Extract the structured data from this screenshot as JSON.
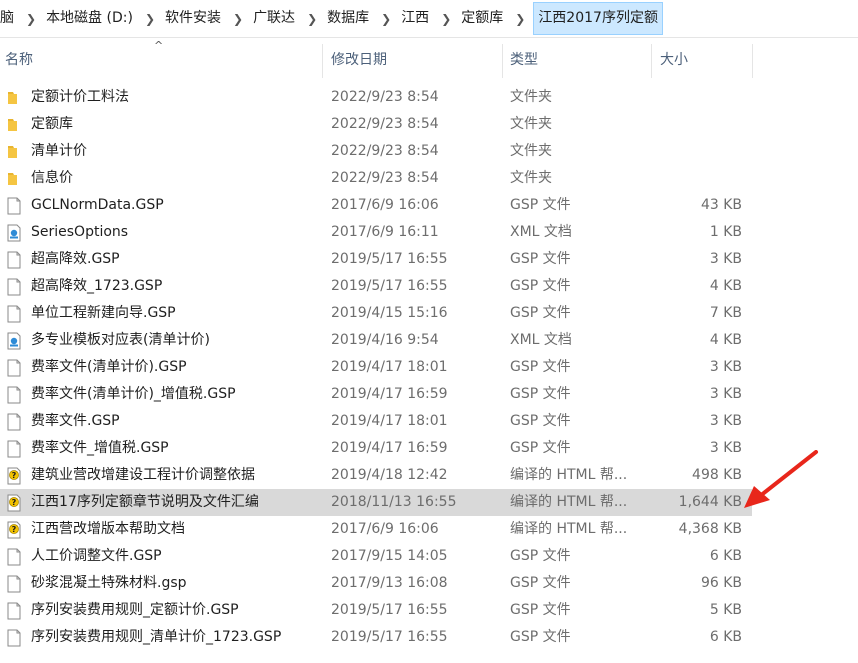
{
  "breadcrumb": {
    "items": [
      "脑",
      "本地磁盘 (D:)",
      "软件安装",
      "广联达",
      "数据库",
      "江西",
      "定额库",
      "江西2017序列定额"
    ]
  },
  "columns": {
    "name": "名称",
    "date": "修改日期",
    "type": "类型",
    "size": "大小"
  },
  "files": [
    {
      "icon": "folder-icon",
      "name": "定额计价工料法",
      "date": "2022/9/23 8:54",
      "type": "文件夹",
      "size": ""
    },
    {
      "icon": "folder-icon",
      "name": "定额库",
      "date": "2022/9/23 8:54",
      "type": "文件夹",
      "size": ""
    },
    {
      "icon": "folder-icon",
      "name": "清单计价",
      "date": "2022/9/23 8:54",
      "type": "文件夹",
      "size": ""
    },
    {
      "icon": "folder-icon",
      "name": "信息价",
      "date": "2022/9/23 8:54",
      "type": "文件夹",
      "size": ""
    },
    {
      "icon": "file-icon",
      "name": "GCLNormData.GSP",
      "date": "2017/6/9 16:06",
      "type": "GSP 文件",
      "size": "43 KB"
    },
    {
      "icon": "xml-file-icon",
      "name": "SeriesOptions",
      "date": "2017/6/9 16:11",
      "type": "XML 文档",
      "size": "1 KB"
    },
    {
      "icon": "file-icon",
      "name": "超高降效.GSP",
      "date": "2019/5/17 16:55",
      "type": "GSP 文件",
      "size": "3 KB"
    },
    {
      "icon": "file-icon",
      "name": "超高降效_1723.GSP",
      "date": "2019/5/17 16:55",
      "type": "GSP 文件",
      "size": "4 KB"
    },
    {
      "icon": "file-icon",
      "name": "单位工程新建向导.GSP",
      "date": "2019/4/15 15:16",
      "type": "GSP 文件",
      "size": "7 KB"
    },
    {
      "icon": "xml-file-icon",
      "name": "多专业模板对应表(清单计价)",
      "date": "2019/4/16 9:54",
      "type": "XML 文档",
      "size": "4 KB"
    },
    {
      "icon": "file-icon",
      "name": "费率文件(清单计价).GSP",
      "date": "2019/4/17 18:01",
      "type": "GSP 文件",
      "size": "3 KB"
    },
    {
      "icon": "file-icon",
      "name": "费率文件(清单计价)_增值税.GSP",
      "date": "2019/4/17 16:59",
      "type": "GSP 文件",
      "size": "3 KB"
    },
    {
      "icon": "file-icon",
      "name": "费率文件.GSP",
      "date": "2019/4/17 18:01",
      "type": "GSP 文件",
      "size": "3 KB"
    },
    {
      "icon": "file-icon",
      "name": "费率文件_增值税.GSP",
      "date": "2019/4/17 16:59",
      "type": "GSP 文件",
      "size": "3 KB"
    },
    {
      "icon": "chm-help-icon",
      "name": "建筑业营改增建设工程计价调整依据",
      "date": "2019/4/18 12:42",
      "type": "编译的 HTML 帮...",
      "size": "498 KB"
    },
    {
      "icon": "chm-help-icon",
      "name": "江西17序列定额章节说明及文件汇编",
      "date": "2018/11/13 16:55",
      "type": "编译的 HTML 帮...",
      "size": "1,644 KB",
      "selected": true
    },
    {
      "icon": "chm-help-icon",
      "name": "江西营改增版本帮助文档",
      "date": "2017/6/9 16:06",
      "type": "编译的 HTML 帮...",
      "size": "4,368 KB"
    },
    {
      "icon": "file-icon",
      "name": "人工价调整文件.GSP",
      "date": "2017/9/15 14:05",
      "type": "GSP 文件",
      "size": "6 KB"
    },
    {
      "icon": "file-icon",
      "name": "砂浆混凝土特殊材料.gsp",
      "date": "2017/9/13 16:08",
      "type": "GSP 文件",
      "size": "96 KB"
    },
    {
      "icon": "file-icon",
      "name": "序列安装费用规则_定额计价.GSP",
      "date": "2019/5/17 16:55",
      "type": "GSP 文件",
      "size": "5 KB"
    },
    {
      "icon": "file-icon",
      "name": "序列安装费用规则_清单计价_1723.GSP",
      "date": "2019/5/17 16:55",
      "type": "GSP 文件",
      "size": "6 KB"
    }
  ],
  "colors": {
    "selection": "#d9d9d9",
    "folder": "#f5c542",
    "arrow": "#e8261b",
    "header_text": "#4c607a"
  }
}
